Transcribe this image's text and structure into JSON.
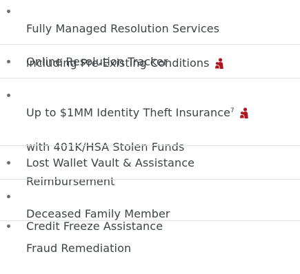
{
  "features": {
    "item1": {
      "line1": "Fully Managed Resolution Services",
      "line2": "including Pre-Existing Conditions",
      "icon": "family-icon"
    },
    "item2": {
      "text": "Online Resolution Tracker"
    },
    "item3": {
      "line1_text": "Up to $1MM Identity Theft Insurance",
      "footnote": "7",
      "line2": "with 401K/HSA Stolen Funds",
      "line3": "Reimbursement",
      "icon": "family-icon"
    },
    "item4": {
      "text": "Lost Wallet Vault & Assistance"
    },
    "item5": {
      "line1": "Deceased Family Member",
      "line2": "Fraud Remediation"
    },
    "item6": {
      "text": "Credit Freeze Assistance"
    }
  },
  "colors": {
    "text": "#3d4244",
    "icon": "#b0141c",
    "divider": "#e3e3e3",
    "bullet": "#6b6f71"
  }
}
